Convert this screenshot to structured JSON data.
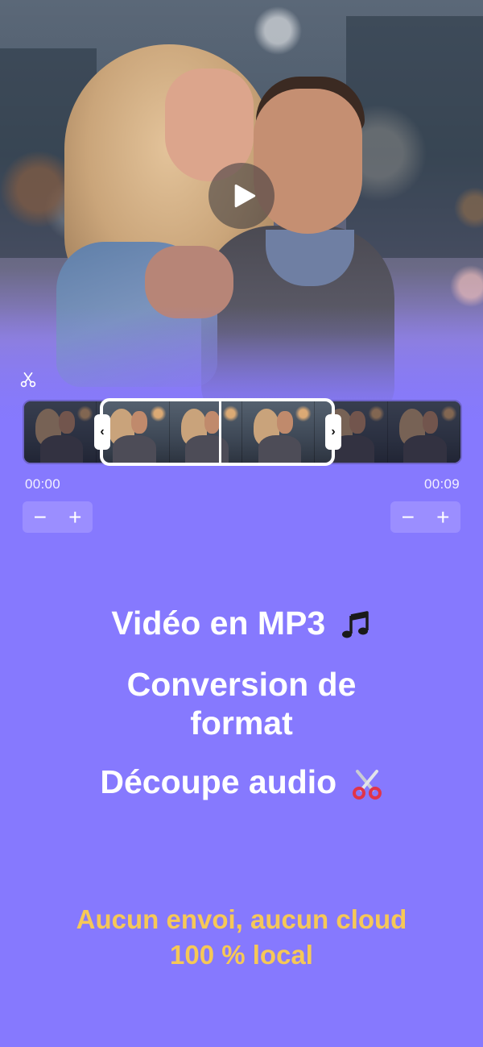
{
  "player": {
    "play_icon": "play-icon"
  },
  "trim": {
    "scissors_icon": "scissors-icon",
    "start_time": "00:00",
    "end_time": "00:09",
    "start_stepper": {
      "minus": "−",
      "plus": "+"
    },
    "end_stepper": {
      "minus": "−",
      "plus": "+"
    },
    "handle_left": "‹",
    "handle_right": "›"
  },
  "features": {
    "line1": "Vidéo en MP3",
    "line1_icon": "music-note-icon",
    "line2a": "Conversion de",
    "line2b": "format",
    "line3": "Découpe audio",
    "line3_icon": "scissors-emoji-icon"
  },
  "tagline": {
    "line1": "Aucun envoi, aucun cloud",
    "line2": "100 % local"
  },
  "colors": {
    "background": "#8679fe",
    "tagline": "#f6c857",
    "stepper": "#9b8eff"
  }
}
